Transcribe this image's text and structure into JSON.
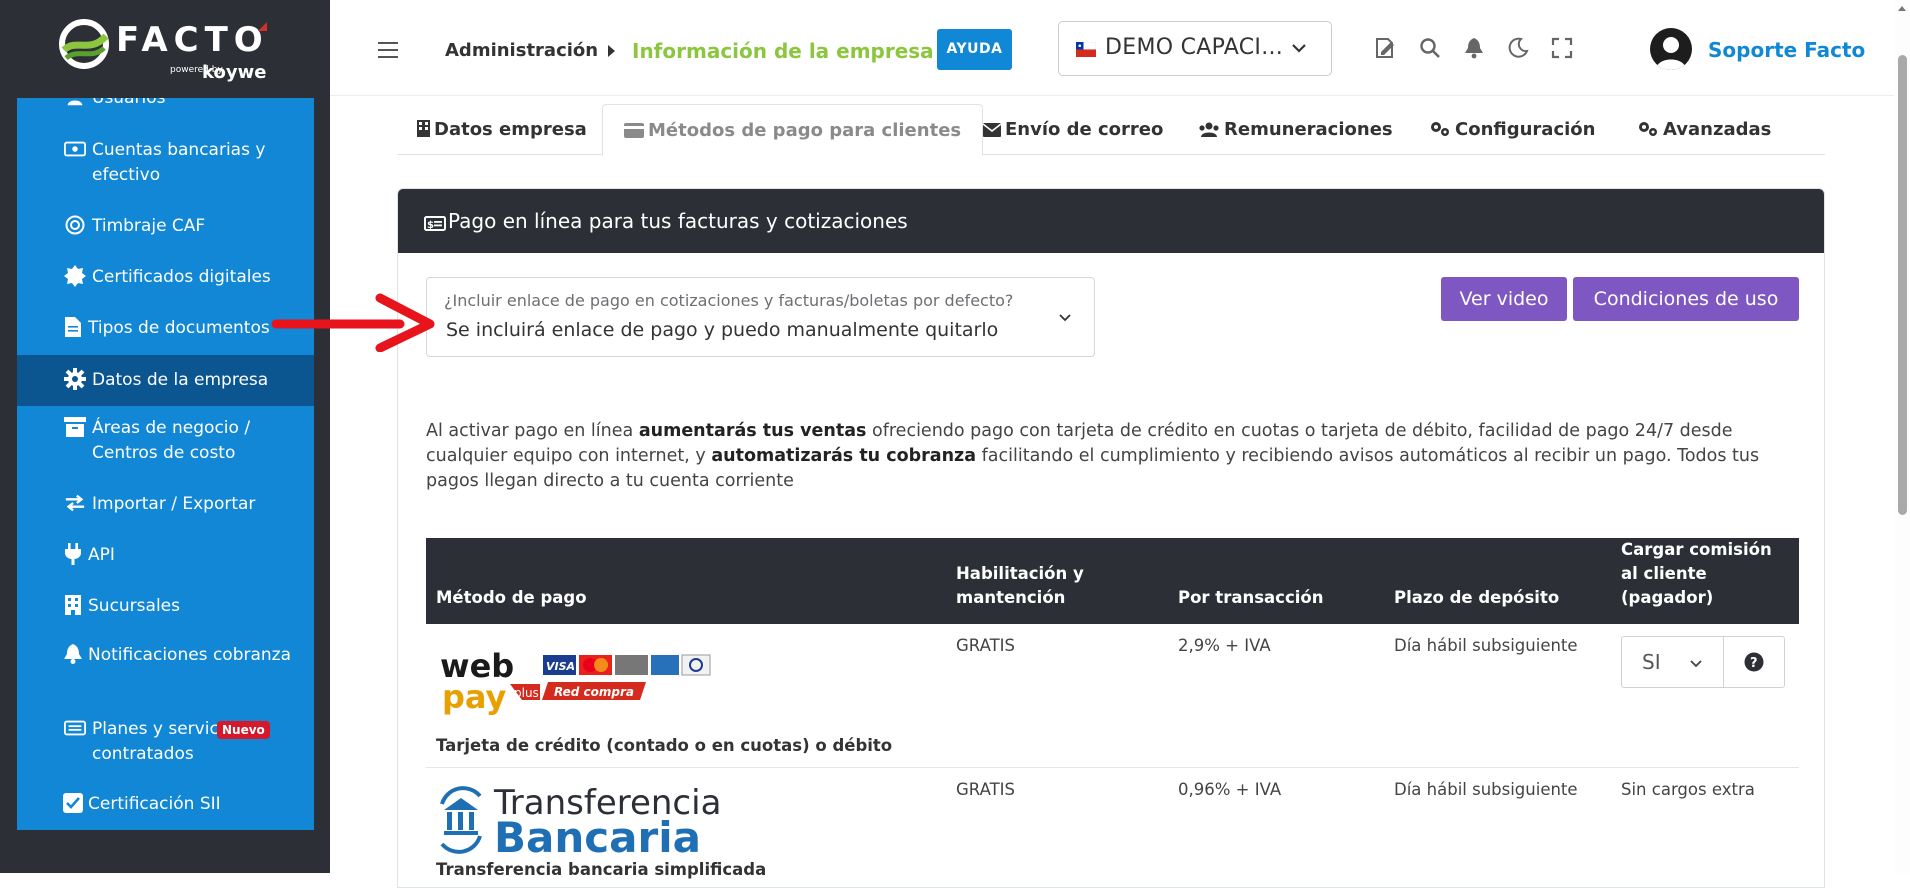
{
  "brand": {
    "logo_text": "FACTO",
    "powered_by": "powered by",
    "partner": "koywe"
  },
  "sidebar": {
    "items": [
      {
        "label": "Usuarios",
        "icon": "users-icon"
      },
      {
        "label": "Cuentas bancarias y efectivo",
        "icon": "money-bill-icon"
      },
      {
        "label": "Timbraje CAF",
        "icon": "stamp-icon"
      },
      {
        "label": "Certificados digitales",
        "icon": "certificate-icon"
      },
      {
        "label": "Tipos de documentos",
        "icon": "document-icon"
      },
      {
        "label": "Datos de la empresa",
        "icon": "gear-icon",
        "active": true
      },
      {
        "label": "Áreas de negocio / Centros de costo",
        "icon": "archive-icon"
      },
      {
        "label": "Importar / Exportar",
        "icon": "exchange-icon"
      },
      {
        "label": "API",
        "icon": "plug-icon"
      },
      {
        "label": "Sucursales",
        "icon": "building-icon"
      },
      {
        "label": "Notificaciones cobranza",
        "icon": "bell-icon"
      },
      {
        "label": "Planes y servicios contratados",
        "icon": "money-bill-icon",
        "badge": "Nuevo"
      },
      {
        "label": "Certificación SII",
        "icon": "check-square-icon"
      }
    ]
  },
  "header": {
    "breadcrumb_parent": "Administración",
    "breadcrumb_current": "Información de la empresa",
    "help_button": "AYUDA",
    "company_selector": "DEMO CAPACI...",
    "user_name": "Soporte Facto"
  },
  "tabs": [
    {
      "label": "Datos empresa",
      "icon": "building-icon"
    },
    {
      "label": "Métodos de pago para clientes",
      "icon": "credit-card-icon",
      "active": true
    },
    {
      "label": "Envío de correo",
      "icon": "envelope-icon"
    },
    {
      "label": "Remuneraciones",
      "icon": "users-icon"
    },
    {
      "label": "Configuración",
      "icon": "gears-icon"
    },
    {
      "label": "Avanzadas",
      "icon": "gears-icon"
    }
  ],
  "panel": {
    "title": "Pago en línea para tus facturas y cotizaciones",
    "select_label": "¿Incluir enlace de pago en cotizaciones y facturas/boletas por defecto?",
    "select_value": "Se incluirá enlace de pago y puedo manualmente quitarlo",
    "video_button": "Ver video",
    "terms_button": "Condiciones de uso",
    "description": {
      "p1": "Al activar pago en línea ",
      "b1": "aumentarás tus ventas",
      "p2": " ofreciendo pago con tarjeta de crédito en cuotas o tarjeta de débito, facilidad de pago 24/7 desde cualquier equipo con internet, y ",
      "b2": "automatizarás tu cobranza",
      "p3": " facilitando el cumplimiento y recibiendo avisos automáticos al recibir un pago. Todos tus pagos llegan directo a tu cuenta corriente"
    }
  },
  "table": {
    "headers": [
      "Método de pago",
      "Habilitación y mantención",
      "Por transacción",
      "Plazo de depósito",
      "Cargar comisión al cliente (pagador)"
    ],
    "rows": [
      {
        "logo": "webpay plus",
        "logo_word1": "web",
        "logo_word2": "pay",
        "logo_plus": "plus",
        "logo_redcompra": "Red compra",
        "method": "Tarjeta de crédito (contado o en cuotas) o débito",
        "setup": "GRATIS",
        "fee": "2,9% + IVA",
        "deposit": "Día hábil subsiguiente",
        "charge_select": "SI"
      },
      {
        "logo_line1": "Transferencia",
        "logo_line2": "Bancaria",
        "method": "Transferencia bancaria simplificada",
        "setup": "GRATIS",
        "fee": "0,96% + IVA",
        "deposit": "Día hábil subsiguiente",
        "charge": "Sin cargos extra"
      }
    ]
  },
  "colors": {
    "sidebar_bg": "#2c3036",
    "menu_blue": "#1187d5",
    "menu_active": "#0b5591",
    "accent_green": "#8cc63f",
    "purple": "#7e57c2",
    "annotation_red": "#e8141b"
  }
}
